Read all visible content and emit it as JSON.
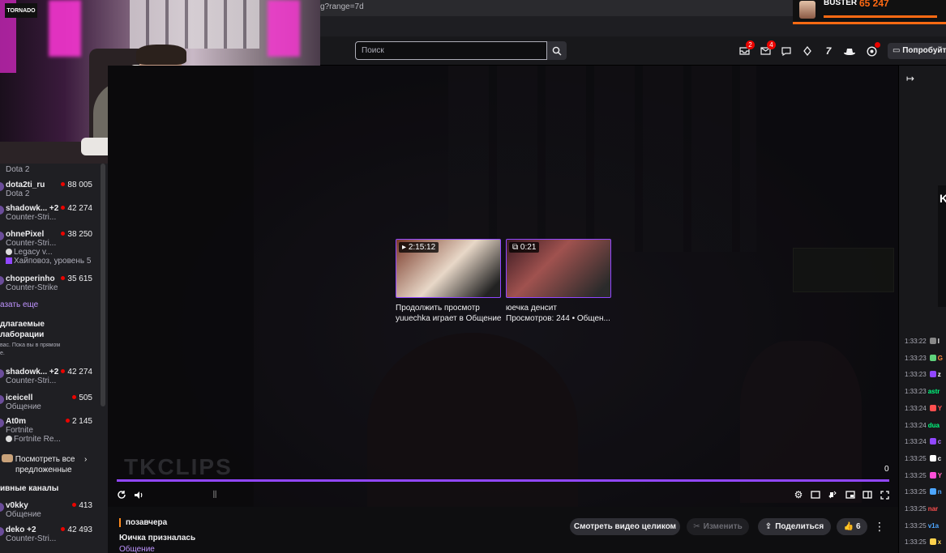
{
  "browser": {
    "url_fragment": "g?range=7d"
  },
  "booster": {
    "name": "BUSTER",
    "count": "65 247"
  },
  "topnav": {
    "search_placeholder": "Поиск",
    "inbox_badge": "2",
    "whispers_badge": "4",
    "try_label": "Попробуйте"
  },
  "sidebar": {
    "channels": [
      {
        "name": "",
        "game": "Dota 2",
        "viewers": ""
      },
      {
        "name": "dota2ti_ru",
        "game": "Dota 2",
        "viewers": "88 005"
      },
      {
        "name": "shadowk...",
        "plus": "+2",
        "game": "Counter-Stri...",
        "viewers": "42 274"
      },
      {
        "name": "ohnePixel",
        "game": "Counter-Stri...",
        "extra": "Legacy v...",
        "extra2": "Хайповоз, уровень 5",
        "viewers": "38 250"
      },
      {
        "name": "chopperinho",
        "game": "Counter-Strike",
        "viewers": "35 615"
      }
    ],
    "show_more": "азать еще",
    "collab_title_1": "длагаемые",
    "collab_title_2": "лаборации",
    "collab_sub_1": "вас. Пока вы в прямом",
    "collab_sub_2": "е.",
    "collabs": [
      {
        "name": "shadowk...",
        "plus": "+2",
        "game": "Counter-Stri...",
        "viewers": "42 274"
      },
      {
        "name": "iceicell",
        "game": "Общение",
        "viewers": "505"
      },
      {
        "name": "At0m",
        "game": "Fortnite",
        "extra": "Fortnite Re...",
        "viewers": "2 145"
      }
    ],
    "see_all_1": "Посмотреть все",
    "see_all_2": "предложенные",
    "active_title": "ивные каналы",
    "active": [
      {
        "name": "v0kky",
        "game": "Общение",
        "viewers": "413"
      },
      {
        "name": "deko",
        "plus": "+2",
        "game": "Counter-Stri...",
        "viewers": "42 493"
      }
    ]
  },
  "player": {
    "watermark": "TKCLIPS",
    "time_end": "0",
    "cards": [
      {
        "duration": "2:15:12",
        "line1": "Продолжить просмотр",
        "line2": "yuuechka играет в Общение"
      },
      {
        "duration": "0:21",
        "line1": "юечка денсит",
        "line2": "Просмотров: 244 • Общен..."
      }
    ]
  },
  "info": {
    "date": "позавчера",
    "title": "Юичка призналась",
    "category": "Общение",
    "watch_full": "Смотреть видео целиком",
    "edit": "Изменить",
    "share": "Поделиться",
    "likes": "6"
  },
  "chat": {
    "promo_letter": "K",
    "messages": [
      {
        "time": "1:33:22",
        "color": "#ffffff",
        "badge": "#888",
        "user": "l"
      },
      {
        "time": "1:33:23",
        "color": "#ff8a3d",
        "badge": "#5fd17b",
        "user": "G"
      },
      {
        "time": "1:33:23",
        "color": "#ffffff",
        "badge": "#9147ff",
        "user": "z"
      },
      {
        "time": "1:33:23",
        "color": "#00ff7f",
        "badge": "",
        "user": "astr"
      },
      {
        "time": "1:33:24",
        "color": "#ff4f4f",
        "badge": "#ff4f4f",
        "user": "Y"
      },
      {
        "time": "1:33:24",
        "color": "#00ff7f",
        "badge": "",
        "user": "dua"
      },
      {
        "time": "1:33:24",
        "color": "#b57bff",
        "badge": "#9147ff",
        "user": "c"
      },
      {
        "time": "1:33:25",
        "color": "#ffffff",
        "badge": "#ffffff",
        "user": "c"
      },
      {
        "time": "1:33:25",
        "color": "#ff69b4",
        "badge": "#ff4fd8",
        "user": "Y"
      },
      {
        "time": "1:33:25",
        "color": "#4da6ff",
        "badge": "#4da6ff",
        "user": "n"
      },
      {
        "time": "1:33:25",
        "color": "#ff4f4f",
        "badge": "",
        "user": "nar"
      },
      {
        "time": "1:33:25",
        "color": "#4da6ff",
        "badge": "",
        "user": "v1a"
      },
      {
        "time": "1:33:25",
        "color": "#ffd24d",
        "badge": "#ffd24d",
        "user": "x"
      }
    ]
  }
}
